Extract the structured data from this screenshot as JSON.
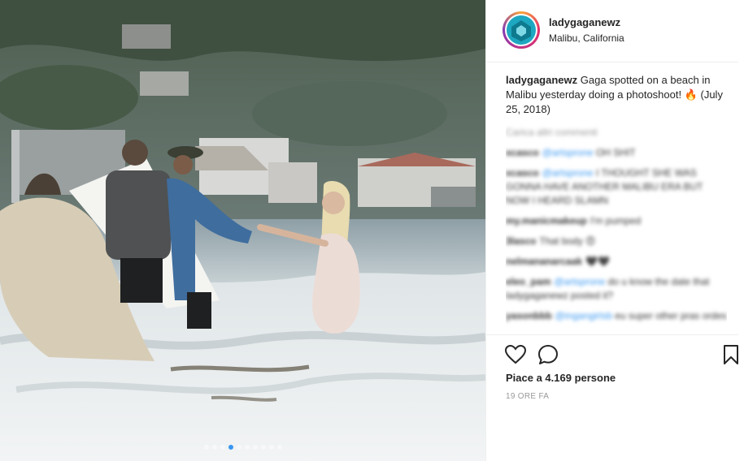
{
  "post": {
    "username": "ladygaganewz",
    "location": "Malibu, California",
    "caption_user": "ladygaganewz",
    "caption_text": "Gaga spotted on a beach in Malibu yesterday doing a photoshoot! 🔥 (July 25, 2018)",
    "load_more": "Carica altri commenti",
    "likes": "Piace a 4.169 persone",
    "time": "19 ORE FA"
  },
  "comments": [
    {
      "user": "xcasco",
      "mention": "@artsprone",
      "text": "OH SHIT"
    },
    {
      "user": "xcasco",
      "mention": "@artsprone",
      "text": "I THOUGHT SHE WAS GONNA HAVE ANOTHER MALIBU ERA BUT NOW I HEARD SLAMN"
    },
    {
      "user": "my.manicmakeup",
      "mention": "",
      "text": "I'm pumped"
    },
    {
      "user": "3lasco",
      "mention": "",
      "text": "That body 😍"
    },
    {
      "user": "nelmananarcaak",
      "mention": "",
      "text": "🖤🖤"
    },
    {
      "user": "eleo_pam",
      "mention": "@artsprone",
      "text": "do u know the date that ladygaganewz posted it?"
    },
    {
      "user": "yasonbbb",
      "mention": "@ingangirlsb",
      "text": "eu super other pras ordes"
    }
  ],
  "carousel": {
    "count": 10,
    "active_index": 3
  },
  "icons": {
    "heart": "heart-icon",
    "comment": "comment-icon",
    "bookmark": "bookmark-icon"
  },
  "colors": {
    "link": "#3897f0",
    "text": "#262626",
    "muted": "#999999"
  }
}
